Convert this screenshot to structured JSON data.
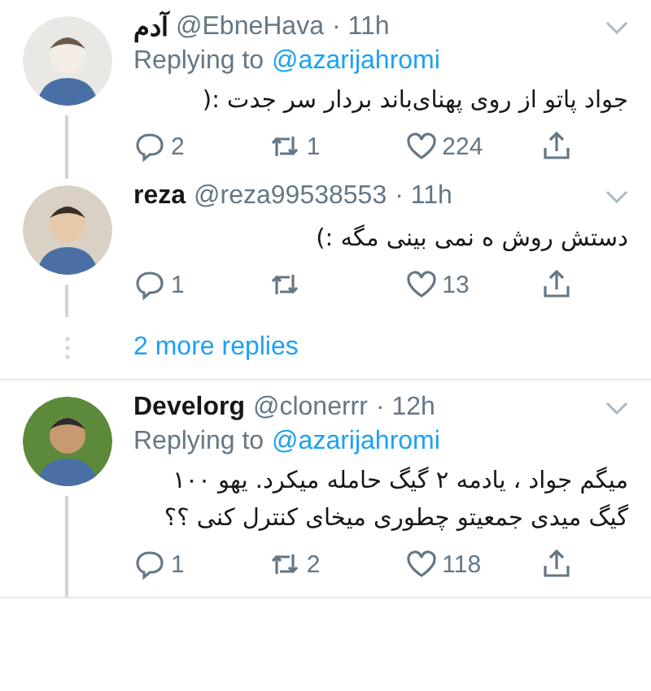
{
  "threads": [
    {
      "tweets": [
        {
          "name": "آدم",
          "handle": "@EbneHava",
          "time": "· 11h",
          "replying_prefix": "Replying to",
          "replying_to": "@azarijahromi",
          "text": "جواد پاتو از روی پهنای‌باند بردار سر جدت :(",
          "replies": "2",
          "retweets": "1",
          "likes": "224"
        },
        {
          "name": "reza",
          "handle": "@reza99538553",
          "time": "· 11h",
          "text": "دستش روش ه نمی بینی مگه :)",
          "replies": "1",
          "likes": "13"
        }
      ],
      "more_replies": "2 more replies"
    },
    {
      "tweets": [
        {
          "name": "Develorg",
          "handle": "@clonerrr",
          "time": "· 12h",
          "replying_prefix": "Replying to",
          "replying_to": "@azarijahromi",
          "text": "میگم جواد ، یادمه ۲ گیگ حامله میکرد. یهو ۱۰۰ گیگ میدی جمعیتو چطوری میخای کنترل کنی ؟؟",
          "replies": "1",
          "retweets": "2",
          "likes": "118"
        }
      ]
    }
  ]
}
